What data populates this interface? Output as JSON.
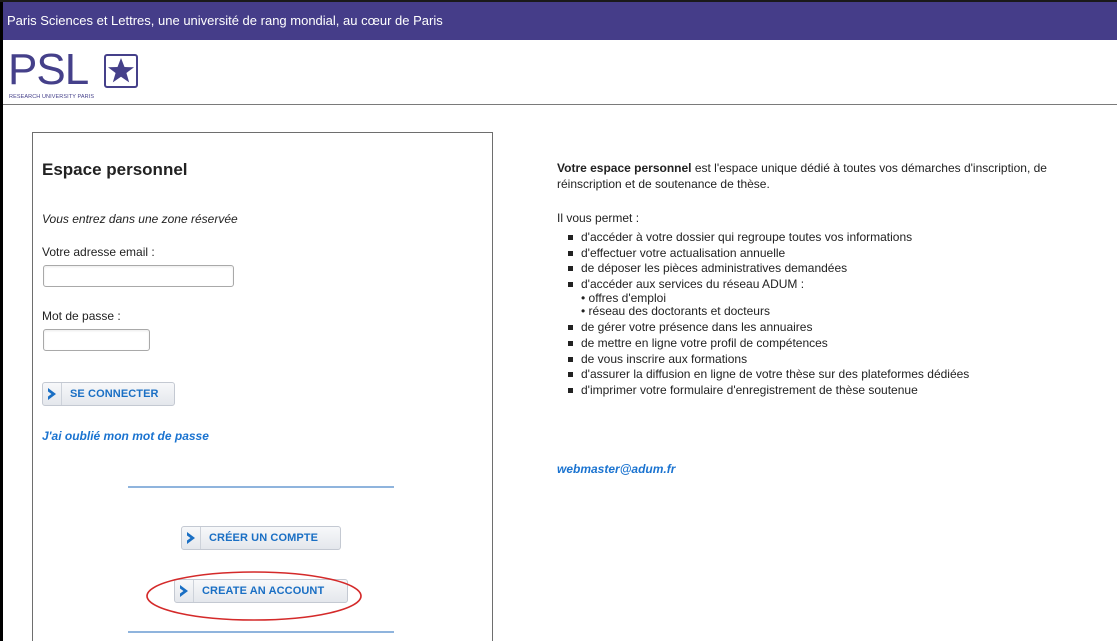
{
  "header": {
    "banner_text": "Paris Sciences et Lettres, une université de rang mondial, au cœur de Paris"
  },
  "logo": {
    "wordmark": "PSL",
    "tagline": "RESEARCH UNIVERSITY PARIS"
  },
  "login": {
    "title": "Espace personnel",
    "restricted_note": "Vous entrez dans une zone réservée",
    "email_label": "Votre adresse email :",
    "email_value": "",
    "password_label": "Mot de passe :",
    "password_value": "",
    "connect_button": "SE CONNECTER",
    "forgot_link": "J'ai oublié mon mot de passe",
    "create_account_fr": "CRÉER UN COMPTE",
    "create_account_en": "CREATE AN ACCOUNT"
  },
  "info": {
    "intro_bold": "Votre espace personnel",
    "intro_rest": " est l'espace unique dédié à toutes vos démarches d'inscription, de",
    "intro_line2": "réinscription et de soutenance de thèse.",
    "permits": "Il vous permet :",
    "items": [
      "d'accéder à votre dossier qui regroupe toutes vos informations",
      "d'effectuer votre actualisation annuelle",
      "de déposer les pièces administratives demandées",
      "d'accéder aux services du réseau ADUM :",
      "de gérer votre présence dans les annuaires",
      "de mettre en ligne votre profil de compétences",
      "de vous inscrire aux formations",
      "d'assurer la diffusion en ligne de votre thèse sur des plateformes dédiées",
      "d'imprimer votre formulaire d'enregistrement de thèse soutenue"
    ],
    "subitems": [
      "• offres d'emploi",
      "• réseau des doctorants et docteurs"
    ],
    "webmaster": "webmaster@adum.fr"
  },
  "colors": {
    "banner": "#453d89",
    "logo": "#45408a",
    "link": "#1a73d0",
    "button_text": "#1a6fc4",
    "highlight_ellipse": "#d42a2a"
  },
  "icons": {
    "button_chevron": "chevron-right-icon",
    "logo_star": "star-icon"
  }
}
